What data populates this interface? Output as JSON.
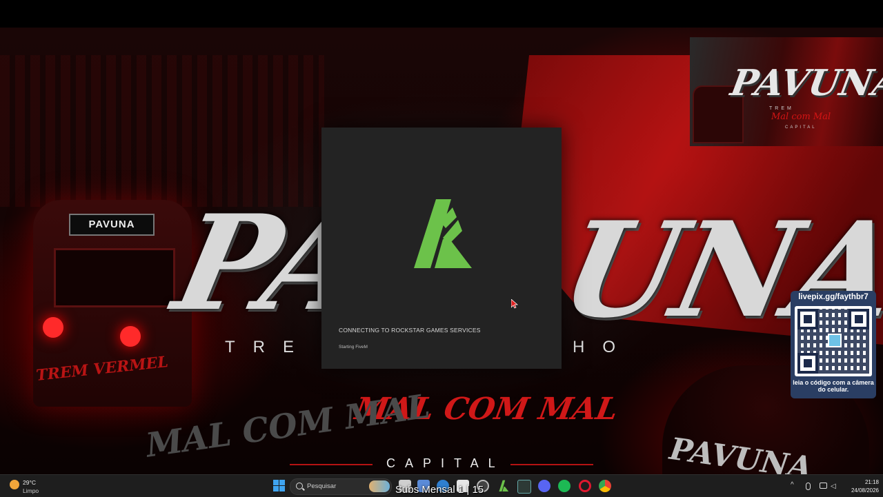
{
  "wallpaper": {
    "train_sign": "PAVUNA",
    "big_word_left": "PA",
    "big_word_right": "UNA",
    "spaced_left": "TRE",
    "spaced_right": "HO",
    "script_main": "MAL COM MAL",
    "capital": "CAPITAL",
    "script_left": "TREM VERMEL",
    "malcom_left": "MAL COM MAL",
    "jacket_text": "PAVUNA"
  },
  "overlay_cam": {
    "title": "PAVUNA",
    "sub": "TREM",
    "script": "Mal com Mal",
    "sub2": "CAPITAL"
  },
  "qr_widget": {
    "url": "livepix.gg/faythbr7",
    "caption": "leia o código com a câmera do celular."
  },
  "launcher": {
    "status": "CONNECTING TO ROCKSTAR GAMES SERVICES",
    "substatus": "Starting FiveM",
    "logo_color": "#6cc24a"
  },
  "taskbar": {
    "weather_temp": "29°C",
    "weather_desc": "Limpo",
    "search_placeholder": "Pesquisar",
    "overlay_text": "Subs Mensal 1 | 15",
    "clock_time": "21:18",
    "clock_date": "24/08/2026",
    "apps": [
      "file-explorer-icon",
      "notes-icon",
      "edge-icon",
      "capture-icon",
      "screenshot-icon",
      "fivem-icon",
      "terminal-icon",
      "discord-icon",
      "spotify-icon",
      "opera-icon",
      "chrome-icon"
    ]
  },
  "colors": {
    "accent_red": "#c01414",
    "fivem_green": "#6cc24a",
    "taskbar_bg": "#1e1e1e",
    "launcher_bg": "#232323"
  }
}
